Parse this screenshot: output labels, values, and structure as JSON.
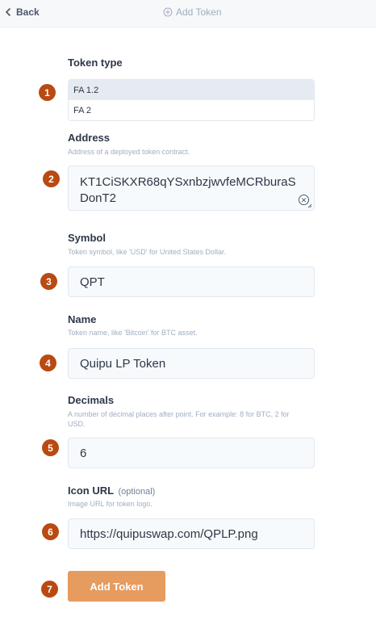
{
  "header": {
    "back_label": "Back",
    "title": "Add Token"
  },
  "form": {
    "token_type": {
      "label": "Token type",
      "options": [
        "FA 1.2",
        "FA 2"
      ],
      "selected": "FA 1.2"
    },
    "address": {
      "label": "Address",
      "hint": "Address of a deployed token contract.",
      "value": "KT1CiSKXR68qYSxnbzjwvfeMCRburaSDonT2"
    },
    "symbol": {
      "label": "Symbol",
      "hint": "Token symbol, like 'USD' for United States Dollar.",
      "value": "QPT"
    },
    "name": {
      "label": "Name",
      "hint": "Token name, like 'Bitcoin' for BTC asset.",
      "value": "Quipu LP Token"
    },
    "decimals": {
      "label": "Decimals",
      "hint": "A number of decimal places after point. For example: 8 for BTC, 2 for USD.",
      "value": "6"
    },
    "icon_url": {
      "label": "Icon URL",
      "optional": "(optional)",
      "hint": "Image URL for token logo.",
      "value": "https://quipuswap.com/QPLP.png"
    },
    "submit_label": "Add Token"
  },
  "badges": [
    "1",
    "2",
    "3",
    "4",
    "5",
    "6",
    "7"
  ],
  "colors": {
    "accent": "#e69b5f",
    "badge": "#b84a12",
    "field_bg": "#f7fafc"
  },
  "icons": {
    "back": "chevron-left-icon",
    "title": "add-circle-icon",
    "clear": "clear-icon"
  }
}
